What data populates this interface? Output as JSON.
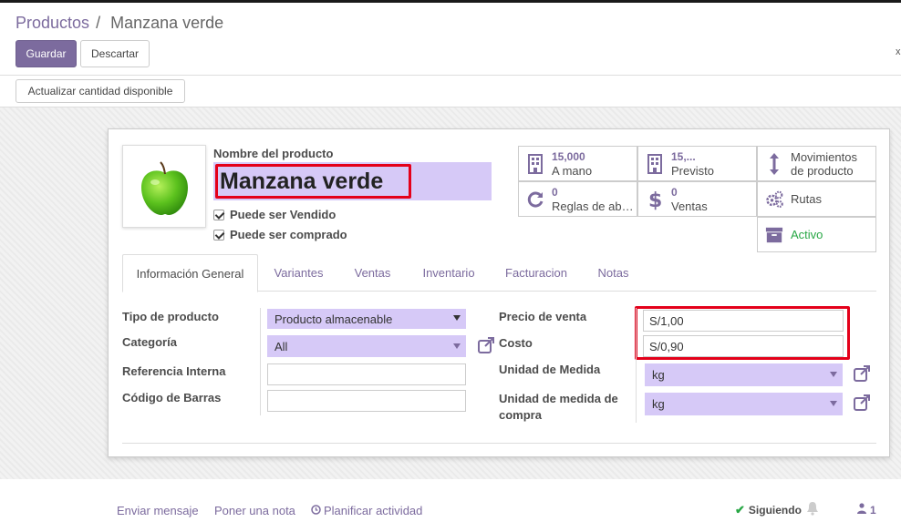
{
  "breadcrumb": {
    "parent": "Productos",
    "separator": "/",
    "current": "Manzana verde"
  },
  "toolbar": {
    "save_label": "Guardar",
    "discard_label": "Descartar",
    "close_mark": "x"
  },
  "actions": {
    "update_qty_label": "Actualizar cantidad disponible"
  },
  "product": {
    "name_label": "Nombre del producto",
    "name_value": "Manzana verde",
    "can_be_sold_label": "Puede ser Vendido",
    "can_be_sold": true,
    "can_be_purchased_label": "Puede ser comprado",
    "can_be_purchased": true,
    "image_icon": "green-apple"
  },
  "smart_buttons": {
    "on_hand": {
      "value": "15,000",
      "label": "A mano",
      "icon": "building-icon"
    },
    "forecasted": {
      "value": "15,...",
      "label": "Previsto",
      "icon": "building-icon"
    },
    "moves": {
      "label_line1": "Movimientos",
      "label_line2": "de producto",
      "icon": "arrows-v-icon"
    },
    "reordering": {
      "value": "0",
      "label": "Reglas de ab…",
      "icon": "refresh-icon"
    },
    "sales": {
      "value": "0",
      "label": "Ventas",
      "icon": "dollar-icon"
    },
    "routes": {
      "label": "Rutas",
      "icon": "cogs-icon"
    },
    "active": {
      "label": "Activo",
      "icon": "archive-icon"
    }
  },
  "tabs": [
    {
      "label": "Información General",
      "active": true
    },
    {
      "label": "Variantes"
    },
    {
      "label": "Ventas"
    },
    {
      "label": "Inventario"
    },
    {
      "label": "Facturacion"
    },
    {
      "label": "Notas"
    }
  ],
  "general": {
    "product_type_label": "Tipo de producto",
    "product_type_value": "Producto almacenable",
    "category_label": "Categoría",
    "category_value": "All",
    "internal_ref_label": "Referencia Interna",
    "internal_ref_value": "",
    "barcode_label": "Código de Barras",
    "barcode_value": "",
    "sale_price_label": "Precio de venta",
    "sale_price_value": "S/1,00",
    "cost_label": "Costo",
    "cost_value": "S/0,90",
    "uom_label": "Unidad de Medida",
    "uom_value": "kg",
    "purchase_uom_label": "Unidad de medida de compra",
    "purchase_uom_value": "kg"
  },
  "chatter": {
    "send_message": "Enviar mensaje",
    "log_note": "Poner una nota",
    "schedule_activity": "Planificar actividad",
    "following": "Siguiendo",
    "followers_count": "1"
  },
  "colors": {
    "primary": "#7c6b9e",
    "field_bg": "#d6c9f7",
    "highlight": "#e4001a",
    "active_green": "#28a745"
  }
}
